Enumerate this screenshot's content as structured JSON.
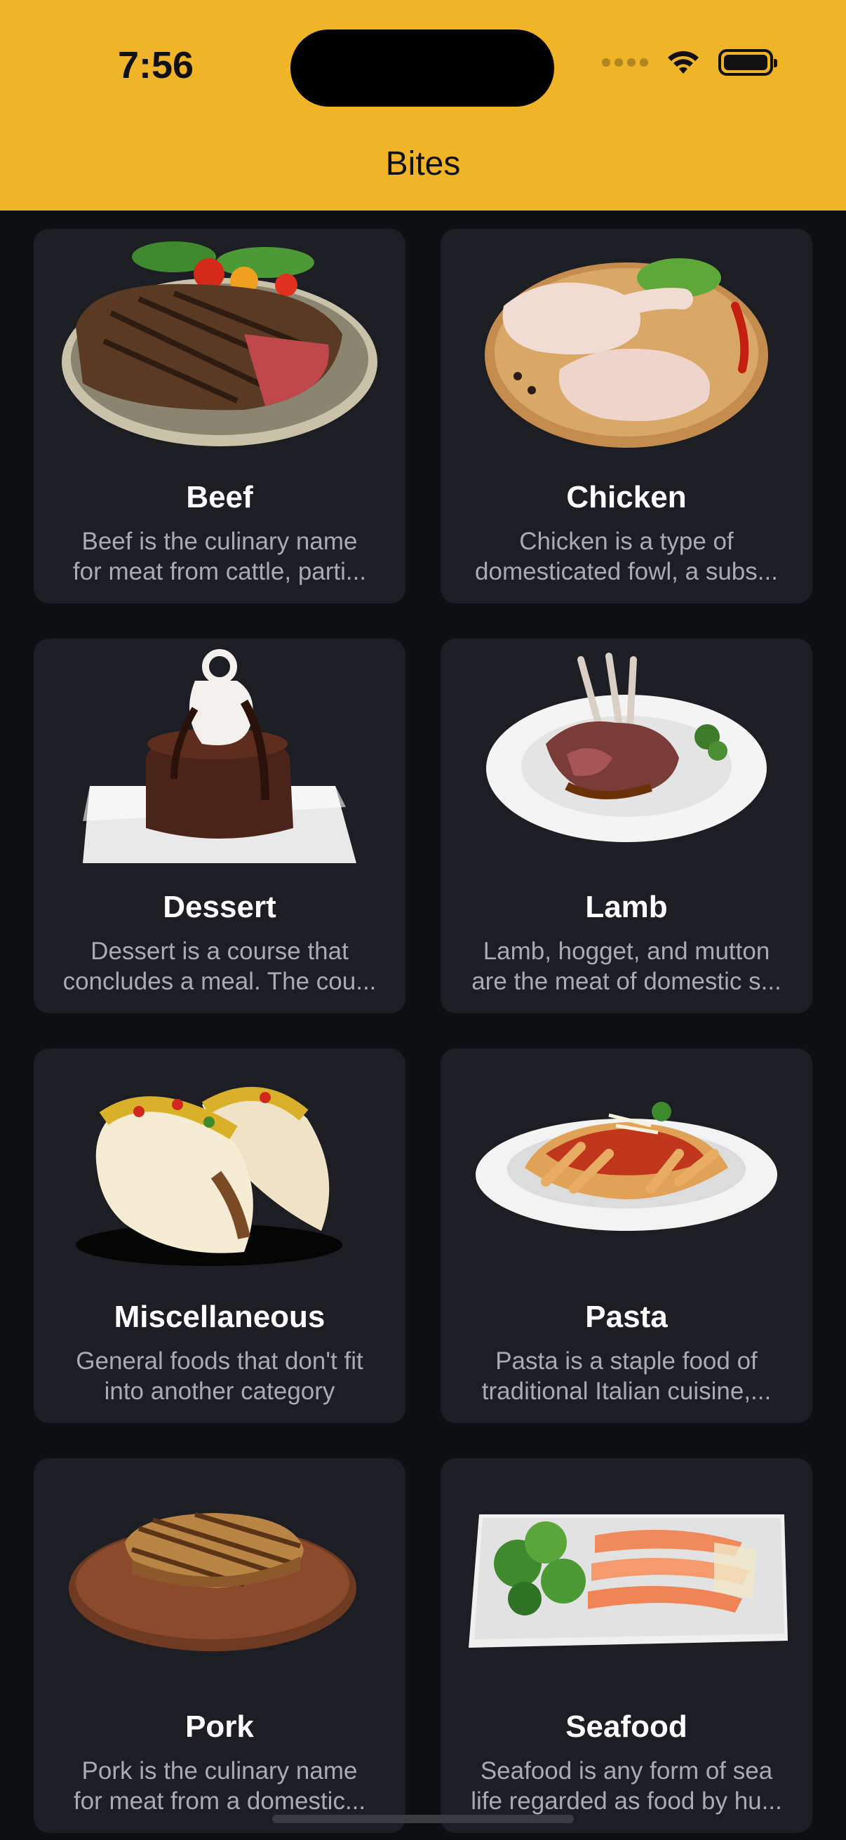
{
  "status": {
    "time": "7:56"
  },
  "app": {
    "title": "Bites"
  },
  "categories": [
    {
      "title": "Beef",
      "desc_line1": "Beef is the culinary name",
      "desc_line2": "for meat from cattle, parti..."
    },
    {
      "title": "Chicken",
      "desc_line1": "Chicken is a type of",
      "desc_line2": "domesticated fowl, a subs..."
    },
    {
      "title": "Dessert",
      "desc_line1": "Dessert is a course that",
      "desc_line2": "concludes a meal. The cou..."
    },
    {
      "title": "Lamb",
      "desc_line1": "Lamb, hogget, and mutton",
      "desc_line2": "are the meat of domestic s..."
    },
    {
      "title": "Miscellaneous",
      "desc_line1": "General foods that don't fit",
      "desc_line2": "into another category"
    },
    {
      "title": "Pasta",
      "desc_line1": "Pasta is a staple food of",
      "desc_line2": "traditional Italian cuisine,..."
    },
    {
      "title": "Pork",
      "desc_line1": "Pork is the culinary name",
      "desc_line2": "for meat from a domestic..."
    },
    {
      "title": "Seafood",
      "desc_line1": "Seafood is any form of sea",
      "desc_line2": "life regarded as food by hu..."
    }
  ],
  "colors": {
    "header": "#f0b429",
    "background": "#0e0f12",
    "card": "#1c1e24"
  }
}
